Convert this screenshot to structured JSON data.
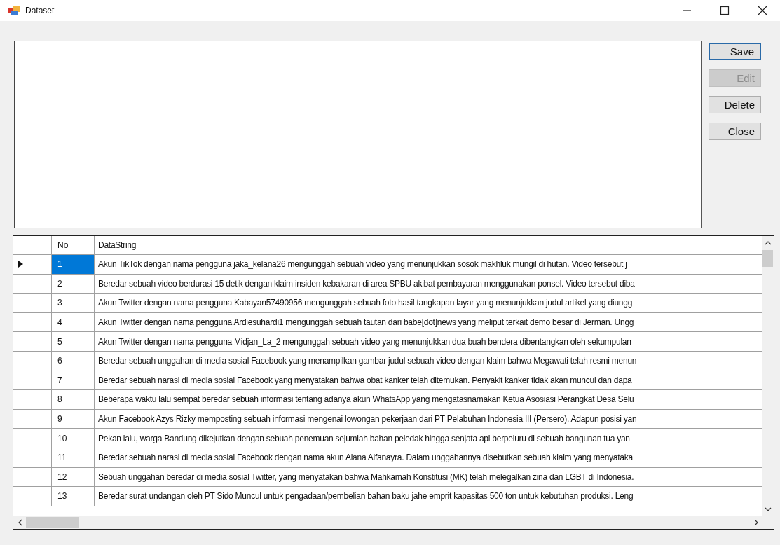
{
  "window": {
    "title": "Dataset"
  },
  "buttons": [
    {
      "label": "Save",
      "disabled": false,
      "focused": true
    },
    {
      "label": "Edit",
      "disabled": true,
      "focused": false
    },
    {
      "label": "Delete",
      "disabled": false,
      "focused": false
    },
    {
      "label": "Close",
      "disabled": false,
      "focused": false
    }
  ],
  "table": {
    "columns": [
      "No",
      "DataString"
    ],
    "rows": [
      {
        "no": "1",
        "text": "Akun TikTok dengan nama pengguna jaka_kelana26 mengunggah sebuah video yang menunjukkan sosok makhluk mungil di hutan. Video tersebut j",
        "selected": true
      },
      {
        "no": "2",
        "text": "Beredar sebuah video berdurasi 15 detik dengan klaim insiden kebakaran di area SPBU akibat pembayaran menggunakan ponsel. Video tersebut diba",
        "selected": false
      },
      {
        "no": "3",
        "text": "Akun Twitter dengan nama pengguna Kabayan57490956 mengunggah sebuah foto hasil tangkapan layar yang menunjukkan judul artikel yang diungg",
        "selected": false
      },
      {
        "no": "4",
        "text": "Akun Twitter dengan nama pengguna Ardiesuhardi1 mengunggah sebuah tautan dari babe[dot]news yang meliput terkait demo besar di Jerman. Ungg",
        "selected": false
      },
      {
        "no": "5",
        "text": "Akun Twitter dengan nama pengguna Midjan_La_2 mengunggah sebuah video yang menunjukkan dua buah bendera dibentangkan oleh sekumpulan",
        "selected": false
      },
      {
        "no": "6",
        "text": "Beredar sebuah unggahan di media sosial Facebook yang menampilkan gambar judul sebuah video dengan klaim bahwa Megawati telah resmi menun",
        "selected": false
      },
      {
        "no": "7",
        "text": "Beredar sebuah narasi di media sosial Facebook yang menyatakan bahwa obat kanker telah ditemukan. Penyakit kanker tidak akan muncul dan dapa",
        "selected": false
      },
      {
        "no": "8",
        "text": "Beberapa waktu lalu sempat beredar sebuah informasi tentang adanya akun WhatsApp yang mengatasnamakan Ketua Asosiasi Perangkat Desa Selu",
        "selected": false
      },
      {
        "no": "9",
        "text": "Akun Facebook Azys Rizky memposting sebuah informasi mengenai lowongan pekerjaan dari PT Pelabuhan Indonesia III (Persero). Adapun posisi yan",
        "selected": false
      },
      {
        "no": "10",
        "text": "Pekan lalu, warga Bandung dikejutkan dengan sebuah penemuan sejumlah bahan peledak hingga senjata api berpeluru di sebuah bangunan tua yan",
        "selected": false
      },
      {
        "no": "11",
        "text": "Beredar sebuah narasi di media sosial Facebook dengan nama akun Alana Alfanayra. Dalam unggahannya disebutkan sebuah klaim yang menyataka",
        "selected": false
      },
      {
        "no": "12",
        "text": "Sebuah unggahan beredar di media sosial Twitter, yang menyatakan bahwa Mahkamah Konstitusi (MK) telah melegalkan zina dan LGBT di Indonesia.",
        "selected": false
      },
      {
        "no": "13",
        "text": "Beredar surat undangan oleh PT Sido Muncul untuk pengadaan/pembelian bahan baku jahe emprit kapasitas 500 ton untuk kebutuhan produksi. Leng",
        "selected": false
      }
    ]
  }
}
